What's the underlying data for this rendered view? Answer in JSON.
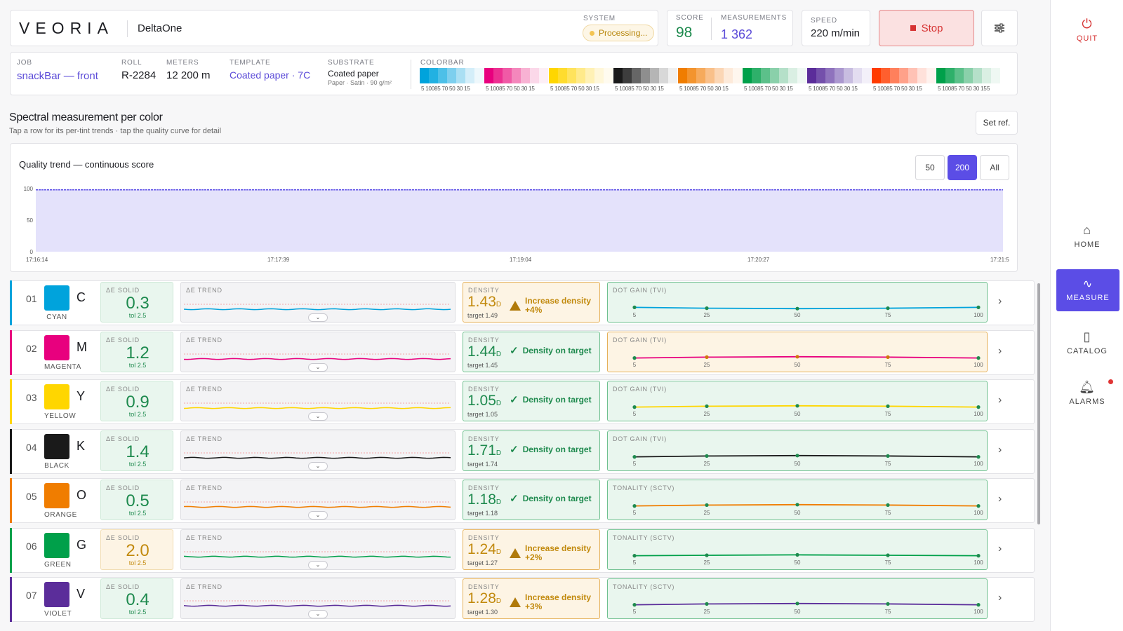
{
  "brand": {
    "logo": "VEORIA",
    "product": "DeltaOne"
  },
  "header": {
    "system_label": "SYSTEM",
    "system_status": "Processing...",
    "score_label": "SCORE",
    "score": "98",
    "measurements_label": "MEASUREMENTS",
    "measurements": "1 362",
    "speed_label": "SPEED",
    "speed": "220 m/min",
    "stop_label": "Stop",
    "settings_icon": "sliders-icon"
  },
  "job": {
    "job_label": "JOB",
    "job": "snackBar — front",
    "roll_label": "ROLL",
    "roll": "R-2284",
    "meters_label": "METERS",
    "meters": "12 200 m",
    "template_label": "TEMPLATE",
    "template": "Coated paper · 7C",
    "substrate_label": "SUBSTRATE",
    "substrate": "Coated paper",
    "substrate_detail": "Paper · Satin · 90 g/m²",
    "colorbar_label": "COLORBAR",
    "colorbar_ticks": "5 10085 70 50 30 15",
    "colorbar_last_tick": "5"
  },
  "colorbar_groups": [
    {
      "name": "cyan",
      "colors": [
        "#00a3dc",
        "#22b1e2",
        "#4dc0e8",
        "#7dcfee",
        "#aadff3",
        "#d4eef9",
        "#eef8fc"
      ]
    },
    {
      "name": "magenta",
      "colors": [
        "#e8007e",
        "#ec2f91",
        "#f05aa6",
        "#f487bc",
        "#f8b2d3",
        "#fbd8e9",
        "#fdeff6"
      ]
    },
    {
      "name": "yellow",
      "colors": [
        "#ffd600",
        "#ffdc2e",
        "#ffe35c",
        "#ffea8a",
        "#fff1b5",
        "#fff7d9",
        "#fffbef"
      ]
    },
    {
      "name": "black",
      "colors": [
        "#1a1a1a",
        "#3d3d3d",
        "#666",
        "#8e8e8e",
        "#b5b5b5",
        "#d8d8d8",
        "#f0f0f0"
      ]
    },
    {
      "name": "orange",
      "colors": [
        "#f07d00",
        "#f3942e",
        "#f6aa5c",
        "#f9c08a",
        "#fbd6b5",
        "#fdeada",
        "#fef6ee"
      ]
    },
    {
      "name": "green",
      "colors": [
        "#00a04a",
        "#2eb06a",
        "#5cc08a",
        "#8ad0aa",
        "#b5e0c9",
        "#daefe3",
        "#eff8f3"
      ]
    },
    {
      "name": "violet",
      "colors": [
        "#5b2d9a",
        "#7450ab",
        "#8f73bd",
        "#ab98cf",
        "#c8bde0",
        "#e3ddf0",
        "#f3f0f9"
      ]
    },
    {
      "name": "red",
      "colors": [
        "#ff3b00",
        "#ff5f2e",
        "#ff805c",
        "#ffa18a",
        "#ffc2b5",
        "#ffe1da",
        "#fff2ee"
      ]
    },
    {
      "name": "green2",
      "colors": [
        "#00a04a",
        "#2eb06a",
        "#5cc08a",
        "#8ad0aa",
        "#b5e0c9",
        "#daefe3",
        "#eff8f3"
      ]
    }
  ],
  "section": {
    "title": "Spectral measurement per color",
    "subtitle": "Tap a row for its per-tint trends · tap the quality curve for detail",
    "set_ref": "Set ref."
  },
  "quality": {
    "title": "Quality trend — continuous score",
    "ranges": [
      "50",
      "200",
      "All"
    ],
    "active_range": "200",
    "y_ticks": [
      "100",
      "50",
      "0"
    ],
    "x_ticks": [
      "17:16:14",
      "17:17:39",
      "17:19:04",
      "17:20:27",
      "17:21:5"
    ],
    "line_color": "#5b4de6",
    "fill_color": "#e4e2fb",
    "chart_data": {
      "type": "area",
      "title": "Quality trend — continuous score",
      "ylim": [
        0,
        100
      ],
      "x": [
        "17:16:14",
        "17:17:39",
        "17:19:04",
        "17:20:27",
        "17:21:5"
      ],
      "series": [
        {
          "values": [
            98,
            98,
            98,
            98,
            98
          ]
        }
      ]
    }
  },
  "rows": [
    {
      "num": "01",
      "letter": "C",
      "name": "CYAN",
      "color": "#00a3dc",
      "de_label": "ΔE SOLID",
      "de": "0.3",
      "tol": "tol 2.5",
      "de_state": "ok",
      "trend_label": "ΔE TREND",
      "density_label": "DENSITY",
      "density": "1.43",
      "density_unit": "D",
      "target": "target 1.49",
      "den_state": "warn",
      "msg1": "Increase density",
      "msg2": "+4%",
      "curve_label": "DOT GAIN (TVI)",
      "curve_state": "ok",
      "x_ticks": [
        "5",
        "25",
        "50",
        "75",
        "100"
      ],
      "curve": [
        6,
        4,
        3,
        4,
        6
      ]
    },
    {
      "num": "02",
      "letter": "M",
      "name": "MAGENTA",
      "color": "#e8007e",
      "de_label": "ΔE SOLID",
      "de": "1.2",
      "tol": "tol 2.5",
      "de_state": "ok",
      "trend_label": "ΔE TREND",
      "density_label": "DENSITY",
      "density": "1.44",
      "density_unit": "D",
      "target": "target 1.45",
      "den_state": "ok",
      "msg1": "Density on target",
      "msg2": "",
      "curve_label": "DOT GAIN (TVI)",
      "curve_state": "warn",
      "x_ticks": [
        "5",
        "25",
        "50",
        "75",
        "100"
      ],
      "curve": [
        4,
        6,
        7,
        6,
        4
      ]
    },
    {
      "num": "03",
      "letter": "Y",
      "name": "YELLOW",
      "color": "#ffd600",
      "de_label": "ΔE SOLID",
      "de": "0.9",
      "tol": "tol 2.5",
      "de_state": "ok",
      "trend_label": "ΔE TREND",
      "density_label": "DENSITY",
      "density": "1.05",
      "density_unit": "D",
      "target": "target 1.05",
      "den_state": "ok",
      "msg1": "Density on target",
      "msg2": "",
      "curve_label": "DOT GAIN (TVI)",
      "curve_state": "ok",
      "x_ticks": [
        "5",
        "25",
        "50",
        "75",
        "100"
      ],
      "curve": [
        4,
        6,
        7,
        6,
        4
      ]
    },
    {
      "num": "04",
      "letter": "K",
      "name": "BLACK",
      "color": "#1a1a1a",
      "de_label": "ΔE SOLID",
      "de": "1.4",
      "tol": "tol 2.5",
      "de_state": "ok",
      "trend_label": "ΔE TREND",
      "density_label": "DENSITY",
      "density": "1.71",
      "density_unit": "D",
      "target": "target 1.74",
      "den_state": "ok",
      "msg1": "Density on target",
      "msg2": "",
      "curve_label": "DOT GAIN (TVI)",
      "curve_state": "ok",
      "x_ticks": [
        "5",
        "25",
        "50",
        "75",
        "100"
      ],
      "curve": [
        4,
        6,
        7,
        6,
        4
      ]
    },
    {
      "num": "05",
      "letter": "O",
      "name": "ORANGE",
      "color": "#f07d00",
      "de_label": "ΔE SOLID",
      "de": "0.5",
      "tol": "tol 2.5",
      "de_state": "ok",
      "trend_label": "ΔE TREND",
      "density_label": "DENSITY",
      "density": "1.18",
      "density_unit": "D",
      "target": "target 1.18",
      "den_state": "ok",
      "msg1": "Density on target",
      "msg2": "",
      "curve_label": "TONALITY (SCTV)",
      "curve_state": "ok",
      "x_ticks": [
        "5",
        "25",
        "50",
        "75",
        "100"
      ],
      "curve": [
        4,
        6,
        7,
        6,
        4
      ]
    },
    {
      "num": "06",
      "letter": "G",
      "name": "GREEN",
      "color": "#00a04a",
      "de_label": "ΔE SOLID",
      "de": "2.0",
      "tol": "tol 2.5",
      "de_state": "warn",
      "trend_label": "ΔE TREND",
      "density_label": "DENSITY",
      "density": "1.24",
      "density_unit": "D",
      "target": "target 1.27",
      "den_state": "warn",
      "msg1": "Increase density",
      "msg2": "+2%",
      "curve_label": "TONALITY (SCTV)",
      "curve_state": "ok",
      "x_ticks": [
        "5",
        "25",
        "50",
        "75",
        "100"
      ],
      "curve": [
        4,
        5,
        6,
        5,
        4
      ]
    },
    {
      "num": "07",
      "letter": "V",
      "name": "VIOLET",
      "color": "#5b2d9a",
      "de_label": "ΔE SOLID",
      "de": "0.4",
      "tol": "tol 2.5",
      "de_state": "ok",
      "trend_label": "ΔE TREND",
      "density_label": "DENSITY",
      "density": "1.28",
      "density_unit": "D",
      "target": "target 1.30",
      "den_state": "warn",
      "msg1": "Increase density",
      "msg2": "+3%",
      "curve_label": "TONALITY (SCTV)",
      "curve_state": "ok",
      "x_ticks": [
        "5",
        "25",
        "50",
        "75",
        "100"
      ],
      "curve": [
        4,
        6,
        7,
        6,
        4
      ]
    }
  ],
  "rail": {
    "quit": "QUIT",
    "home": "HOME",
    "measure": "MEASURE",
    "catalog": "CATALOG",
    "alarms": "ALARMS"
  }
}
